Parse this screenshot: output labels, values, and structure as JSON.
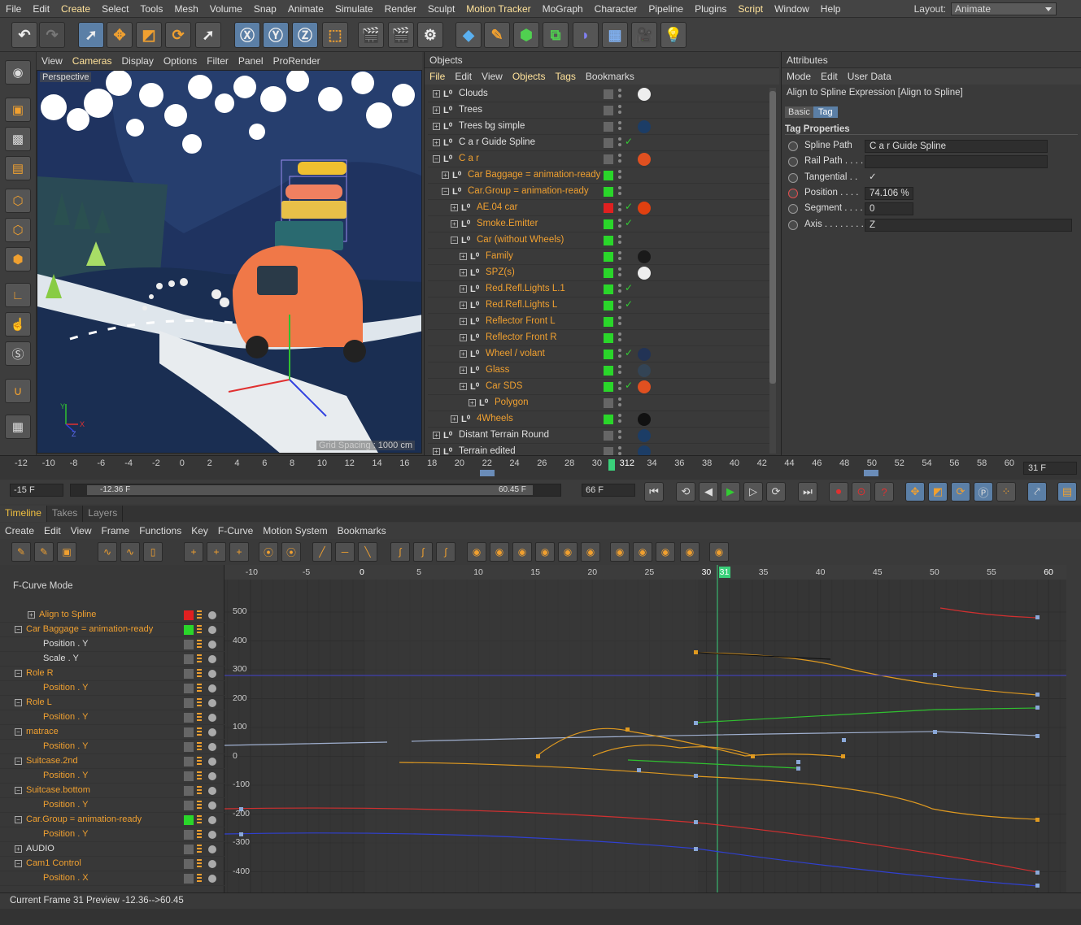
{
  "menu": [
    "File",
    "Edit",
    "Create",
    "Select",
    "Tools",
    "Mesh",
    "Volume",
    "Snap",
    "Animate",
    "Simulate",
    "Render",
    "Sculpt",
    "Motion Tracker",
    "MoGraph",
    "Character",
    "Pipeline",
    "Plugins",
    "Script",
    "Window",
    "Help"
  ],
  "layout": {
    "label": "Layout:",
    "value": "Animate"
  },
  "viewport": {
    "menu": [
      "View",
      "Cameras",
      "Display",
      "Options",
      "Filter",
      "Panel",
      "ProRender"
    ],
    "label": "Perspective",
    "grid": "Grid Spacing : 1000 cm",
    "axis": [
      "Y",
      "X",
      "Z"
    ]
  },
  "objects": {
    "title": "Objects",
    "menu": [
      "File",
      "Edit",
      "View",
      "Objects",
      "Tags",
      "Bookmarks"
    ],
    "rows": [
      {
        "name": "Clouds",
        "indent": 0,
        "orange": false,
        "sq": "n",
        "ck": false,
        "tag": "#eeeeee"
      },
      {
        "name": "Trees",
        "indent": 0,
        "orange": false,
        "sq": "n",
        "ck": false,
        "tag": ""
      },
      {
        "name": "Trees bg simple",
        "indent": 0,
        "orange": false,
        "sq": "n",
        "ck": false,
        "tag": "#1c3d66"
      },
      {
        "name": "C a r Guide Spline",
        "indent": 0,
        "orange": false,
        "sq": "n",
        "ck": true,
        "tag": ""
      },
      {
        "name": "C a r",
        "indent": 0,
        "orange": true,
        "sq": "n",
        "ck": false,
        "tag": "#e05020"
      },
      {
        "name": "Car Baggage = animation-ready",
        "indent": 1,
        "orange": true,
        "sq": "g",
        "ck": false,
        "tag": ""
      },
      {
        "name": "Car.Group = animation-ready",
        "indent": 1,
        "orange": true,
        "sq": "g",
        "ck": false,
        "tag": ""
      },
      {
        "name": "AE.04 car",
        "indent": 2,
        "orange": true,
        "sq": "r",
        "ck": true,
        "tag": "#e04010"
      },
      {
        "name": "Smoke.Emitter",
        "indent": 2,
        "orange": true,
        "sq": "g",
        "ck": true,
        "tag": ""
      },
      {
        "name": "Car (without Wheels)",
        "indent": 2,
        "orange": true,
        "sq": "g",
        "ck": false,
        "tag": ""
      },
      {
        "name": "Family",
        "indent": 3,
        "orange": true,
        "sq": "g",
        "ck": false,
        "tag": "#1a1a1a"
      },
      {
        "name": "SPZ(s)",
        "indent": 3,
        "orange": true,
        "sq": "g",
        "ck": false,
        "tag": "#eeeeee"
      },
      {
        "name": "Red.Refl.Lights L.1",
        "indent": 3,
        "orange": true,
        "sq": "g",
        "ck": true,
        "tag": ""
      },
      {
        "name": "Red.Refl.Lights L",
        "indent": 3,
        "orange": true,
        "sq": "g",
        "ck": true,
        "tag": ""
      },
      {
        "name": "Reflector Front L",
        "indent": 3,
        "orange": true,
        "sq": "g",
        "ck": false,
        "tag": ""
      },
      {
        "name": "Reflector Front R",
        "indent": 3,
        "orange": true,
        "sq": "g",
        "ck": false,
        "tag": ""
      },
      {
        "name": "Wheel / volant",
        "indent": 3,
        "orange": true,
        "sq": "g",
        "ck": true,
        "tag": "#223355"
      },
      {
        "name": "Glass",
        "indent": 3,
        "orange": true,
        "sq": "g",
        "ck": false,
        "tag": "#334455"
      },
      {
        "name": "Car SDS",
        "indent": 3,
        "orange": true,
        "sq": "g",
        "ck": true,
        "tag": "#e05020"
      },
      {
        "name": "Polygon",
        "indent": 4,
        "orange": true,
        "sq": "n",
        "ck": false,
        "tag": ""
      },
      {
        "name": "4Wheels",
        "indent": 2,
        "orange": true,
        "sq": "g",
        "ck": false,
        "tag": "#111111"
      },
      {
        "name": "Distant Terrain Round",
        "indent": 0,
        "orange": false,
        "sq": "n",
        "ck": false,
        "tag": "#1c3d66"
      },
      {
        "name": "Terrain edited",
        "indent": 0,
        "orange": false,
        "sq": "n",
        "ck": false,
        "tag": "#1c3d66"
      }
    ]
  },
  "attributes": {
    "title": "Attributes",
    "menu": [
      "Mode",
      "Edit",
      "User Data"
    ],
    "header": "Align to Spline Expression [Align to Spline]",
    "tabs": [
      "Basic",
      "Tag"
    ],
    "section": "Tag Properties",
    "fields": [
      {
        "label": "Spline Path",
        "value": "C a r Guide Spline"
      },
      {
        "label": "Rail Path . . . .",
        "value": ""
      },
      {
        "label": "Tangential . .",
        "value": "✓"
      },
      {
        "label": "Position . . . .",
        "value": "74.106 %"
      },
      {
        "label": "Segment . . . .",
        "value": "0"
      },
      {
        "label": "Axis . . . . . . . . .",
        "value": "Z"
      }
    ]
  },
  "ruler": {
    "ticks": [
      "-12",
      "-10",
      "-8",
      "-6",
      "-4",
      "-2",
      "0",
      "2",
      "4",
      "6",
      "8",
      "10",
      "12",
      "14",
      "16",
      "18",
      "20",
      "22",
      "24",
      "26",
      "28",
      "30",
      "312",
      "34",
      "36",
      "38",
      "40",
      "42",
      "44",
      "46",
      "48",
      "50",
      "52",
      "54",
      "56",
      "58",
      "60"
    ],
    "current": "31 F"
  },
  "transport": {
    "start": "-15 F",
    "rangeL": "-12.36 F",
    "rangeR": "60.45 F",
    "end": "66 F"
  },
  "timeline": {
    "tabs": [
      "Timeline",
      "Takes",
      "Layers"
    ],
    "menu": [
      "Create",
      "Edit",
      "View",
      "Frame",
      "Functions",
      "Key",
      "F-Curve",
      "Motion System",
      "Bookmarks"
    ],
    "mode": "F-Curve Mode",
    "rows": [
      {
        "name": "Align to Spline",
        "indent": 1,
        "orange": true,
        "pen": "r"
      },
      {
        "name": "Car Baggage = animation-ready",
        "indent": 0,
        "orange": true,
        "pen": "g"
      },
      {
        "name": "Position . Y",
        "indent": 2,
        "orange": false,
        "pen": "n"
      },
      {
        "name": "Scale . Y",
        "indent": 2,
        "orange": false,
        "pen": "n"
      },
      {
        "name": "Role R",
        "indent": 0,
        "orange": true,
        "pen": "n"
      },
      {
        "name": "Position . Y",
        "indent": 2,
        "orange": true,
        "pen": "n"
      },
      {
        "name": "Role L",
        "indent": 0,
        "orange": true,
        "pen": "n"
      },
      {
        "name": "Position . Y",
        "indent": 2,
        "orange": true,
        "pen": "n"
      },
      {
        "name": "matrace",
        "indent": 0,
        "orange": true,
        "pen": "n"
      },
      {
        "name": "Position . Y",
        "indent": 2,
        "orange": true,
        "pen": "n"
      },
      {
        "name": "Suitcase.2nd",
        "indent": 0,
        "orange": true,
        "pen": "n"
      },
      {
        "name": "Position . Y",
        "indent": 2,
        "orange": true,
        "pen": "n"
      },
      {
        "name": "Suitcase.bottom",
        "indent": 0,
        "orange": true,
        "pen": "n"
      },
      {
        "name": "Position . Y",
        "indent": 2,
        "orange": true,
        "pen": "n"
      },
      {
        "name": "Car.Group = animation-ready",
        "indent": 0,
        "orange": true,
        "pen": "g"
      },
      {
        "name": "Position . Y",
        "indent": 2,
        "orange": true,
        "pen": "n"
      },
      {
        "name": "AUDIO",
        "indent": 0,
        "orange": false,
        "pen": "n"
      },
      {
        "name": "Cam1 Control",
        "indent": 0,
        "orange": true,
        "pen": "n"
      },
      {
        "name": "Position . X",
        "indent": 2,
        "orange": true,
        "pen": "n"
      }
    ]
  },
  "graph": {
    "xticks": [
      "-10",
      "-5",
      "0",
      "5",
      "10",
      "15",
      "20",
      "25",
      "30",
      "31",
      "35",
      "40",
      "45",
      "50",
      "55",
      "60"
    ],
    "yticks": [
      "500",
      "400",
      "300",
      "200",
      "100",
      "0",
      "-100",
      "-200",
      "-300",
      "-400"
    ]
  },
  "status": "Current Frame  31  Preview  -12.36-->60.45"
}
